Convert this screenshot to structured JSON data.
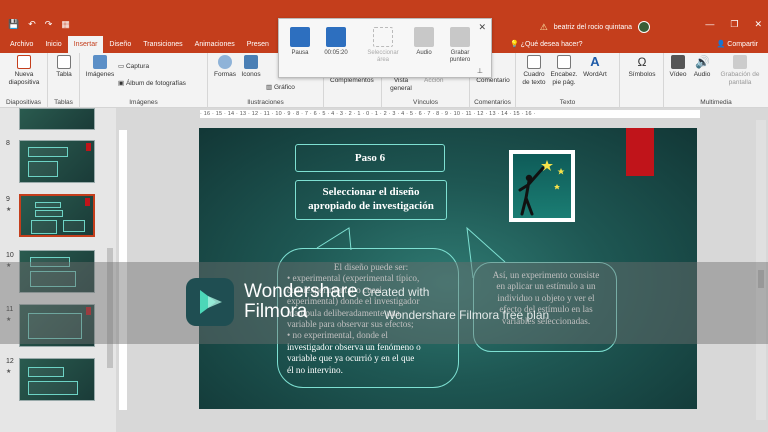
{
  "titlebar": {
    "qat_icons": [
      "save-icon",
      "undo-icon",
      "redo-icon",
      "present-icon"
    ],
    "warning_text": "beatriz del rocio quintana",
    "window_controls": [
      "—",
      "❐",
      "✕"
    ]
  },
  "tabs": [
    "Archivo",
    "Inicio",
    "Insertar",
    "Diseño",
    "Transiciones",
    "Animaciones",
    "Presen"
  ],
  "active_tab": "Insertar",
  "tell_me": "¿Qué desea hacer?",
  "share": "Compartir",
  "ribbon": {
    "nueva": "Nueva diapositiva",
    "diapositivas": "Diapositivas",
    "tabla": "Tabla",
    "tablas": "Tablas",
    "imagenes_btn": "Imágenes",
    "captura": "Captura",
    "album": "Álbum de fotografías",
    "imagenes_grp": "Imágenes",
    "formas": "Formas",
    "iconos": "Iconos",
    "grafico": "Gráfico",
    "ilustraciones": "Ilustraciones",
    "complementos": "Complementos",
    "vista": "Vista general",
    "accion": "Acción",
    "vinculos": "Vínculos",
    "comentario": "Comentario",
    "comentarios": "Comentarios",
    "cuadro": "Cuadro de texto",
    "encabez": "Encabez. pie pág.",
    "wordart": "WordArt",
    "texto": "Texto",
    "simbolos": "Símbolos",
    "video": "Vídeo",
    "audio": "Audio",
    "grabacion": "Grabación de pantalla",
    "multimedia": "Multimedia"
  },
  "recorder": {
    "pausa": "Pausa",
    "time": "00:05:20",
    "seleccionar": "Seleccionar área",
    "audio": "Audio",
    "grabar": "Grabar puntero"
  },
  "thumbs": [
    {
      "num": "8"
    },
    {
      "num": "9",
      "selected": true
    },
    {
      "num": "10"
    },
    {
      "num": "11"
    },
    {
      "num": "12"
    }
  ],
  "ruler_text": "· 16 · 15 · 14 · 13 · 12 · 11 · 10 · 9 · 8 · 7 · 6 · 5 · 4 · 3 · 2 · 1 · 0 · 1 · 2 · 3 · 4 · 5 · 6 · 7 · 8 · 9 · 10 · 11 · 12 · 13 · 14 · 15 · 16 ·",
  "slide": {
    "step": "Paso 6",
    "heading_line1": "Seleccionar el diseño",
    "heading_line2": "apropiado de investigación",
    "left_lines": [
      "El diseño puede ser:",
      "• experimental (experimental típico,",
      "cuasiexperimental o cuasi",
      "experimental) donde el investigador",
      "manipula deliberadamente una",
      "variable para observar sus efectos;",
      "• no experimental, donde el",
      "investigador observa un fenómeno o",
      "variable que ya ocurrió y en el que",
      "él no intervino."
    ],
    "right_lines": [
      "Así, un experimento consiste",
      "en aplicar un estímulo a un",
      "individuo u objeto y ver el",
      "efecto del estímulo en las",
      "variables seleccionadas."
    ]
  },
  "watermark": {
    "brand1": "Wondershare",
    "brand2": "Filmora",
    "created": "Created with",
    "plan": "Wondershare Filmora free plan"
  }
}
